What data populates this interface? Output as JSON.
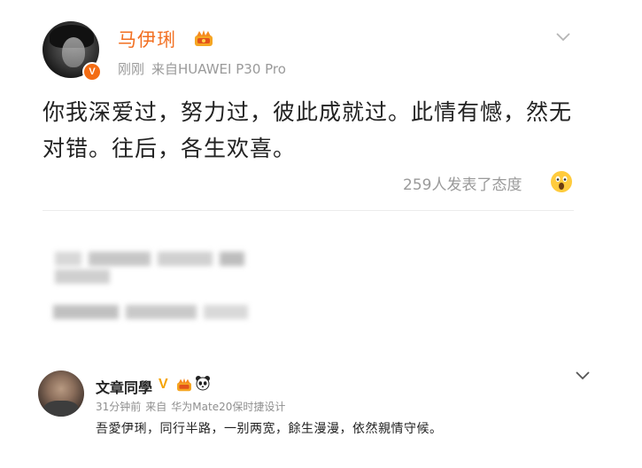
{
  "post1": {
    "author": "马伊琍",
    "time": "刚刚",
    "source_prefix": "来自",
    "source": "HUAWEI P30 Pro",
    "body": "你我深爱过，努力过，彼此成就过。此情有憾，然无对错。往后，各生欢喜。",
    "reactions": "259人发表了态度",
    "verified_mark": "V"
  },
  "post2": {
    "author": "文章同學",
    "verified_mark": "V",
    "time": "31分钟前",
    "source_prefix": "来自",
    "source": "华为Mate20保时捷设计",
    "body": "吾愛伊琍，同行半路，一别两宽，餘生漫漫，依然親情守候。"
  },
  "colors": {
    "author_orange": "#f26f21",
    "gray_text": "#9a9a9a",
    "body_text": "#222222",
    "verified_gold": "#f5a300"
  },
  "icons": [
    "chevron-down-icon",
    "crown-icon",
    "wow-emoji-icon",
    "verified-icon",
    "panda-icon"
  ]
}
